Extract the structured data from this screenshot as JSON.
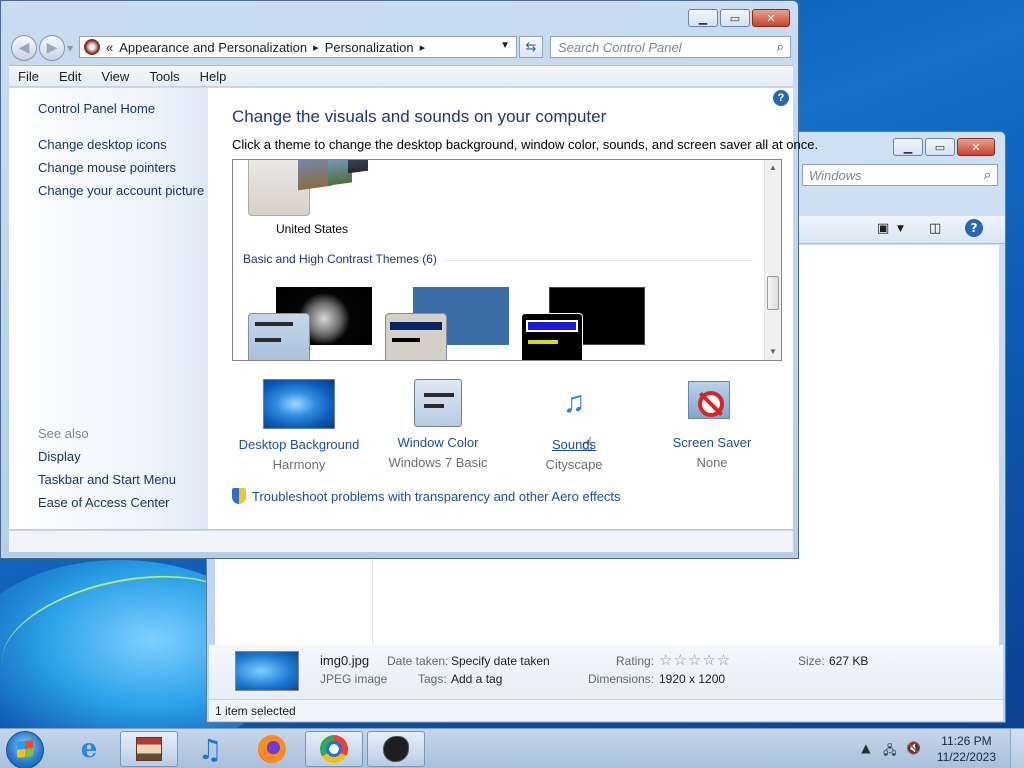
{
  "window": {
    "address": {
      "chevron": "«",
      "crumb1": "Appearance and Personalization",
      "crumb2": "Personalization"
    },
    "search_placeholder": "Search Control Panel",
    "menu": [
      "File",
      "Edit",
      "View",
      "Tools",
      "Help"
    ],
    "left_pane": {
      "home": "Control Panel Home",
      "links": [
        "Change desktop icons",
        "Change mouse pointers",
        "Change your account picture"
      ],
      "see_also_label": "See also",
      "see_also": [
        "Display",
        "Taskbar and Start Menu",
        "Ease of Access Center"
      ]
    },
    "main": {
      "headline": "Change the visuals and sounds on your computer",
      "subline": "Click a theme to change the desktop background, window color, sounds, and screen saver all at once.",
      "theme_selected_label": "United States",
      "group_title": "Basic and High Contrast Themes (6)",
      "tiles": [
        {
          "name": "Desktop Background",
          "sub": "Harmony",
          "icon": "desktop-background-icon"
        },
        {
          "name": "Window Color",
          "sub": "Windows 7 Basic",
          "icon": "window-color-icon"
        },
        {
          "name": "Sounds",
          "sub": "Cityscape",
          "icon": "sounds-icon"
        },
        {
          "name": "Screen Saver",
          "sub": "None",
          "icon": "screen-saver-icon"
        }
      ],
      "troubleshoot": "Troubleshoot problems with transparency and other Aero effects"
    }
  },
  "back_window": {
    "search_text": "Windows",
    "details": {
      "filename": "img0.jpg",
      "filetype": "JPEG image",
      "date_taken_label": "Date taken:",
      "date_taken_value": "Specify date taken",
      "tags_label": "Tags:",
      "tags_value": "Add a tag",
      "rating_label": "Rating:",
      "rating_stars": "☆☆☆☆☆",
      "dimensions_label": "Dimensions:",
      "dimensions_value": "1920 x 1200",
      "size_label": "Size:",
      "size_value": "627 KB"
    },
    "status": "1 item selected"
  },
  "taskbar": {
    "clock_time": "11:26 PM",
    "clock_date": "11/22/2023"
  },
  "colors": {
    "link": "#1a4f9c",
    "headline": "#1e3287"
  }
}
